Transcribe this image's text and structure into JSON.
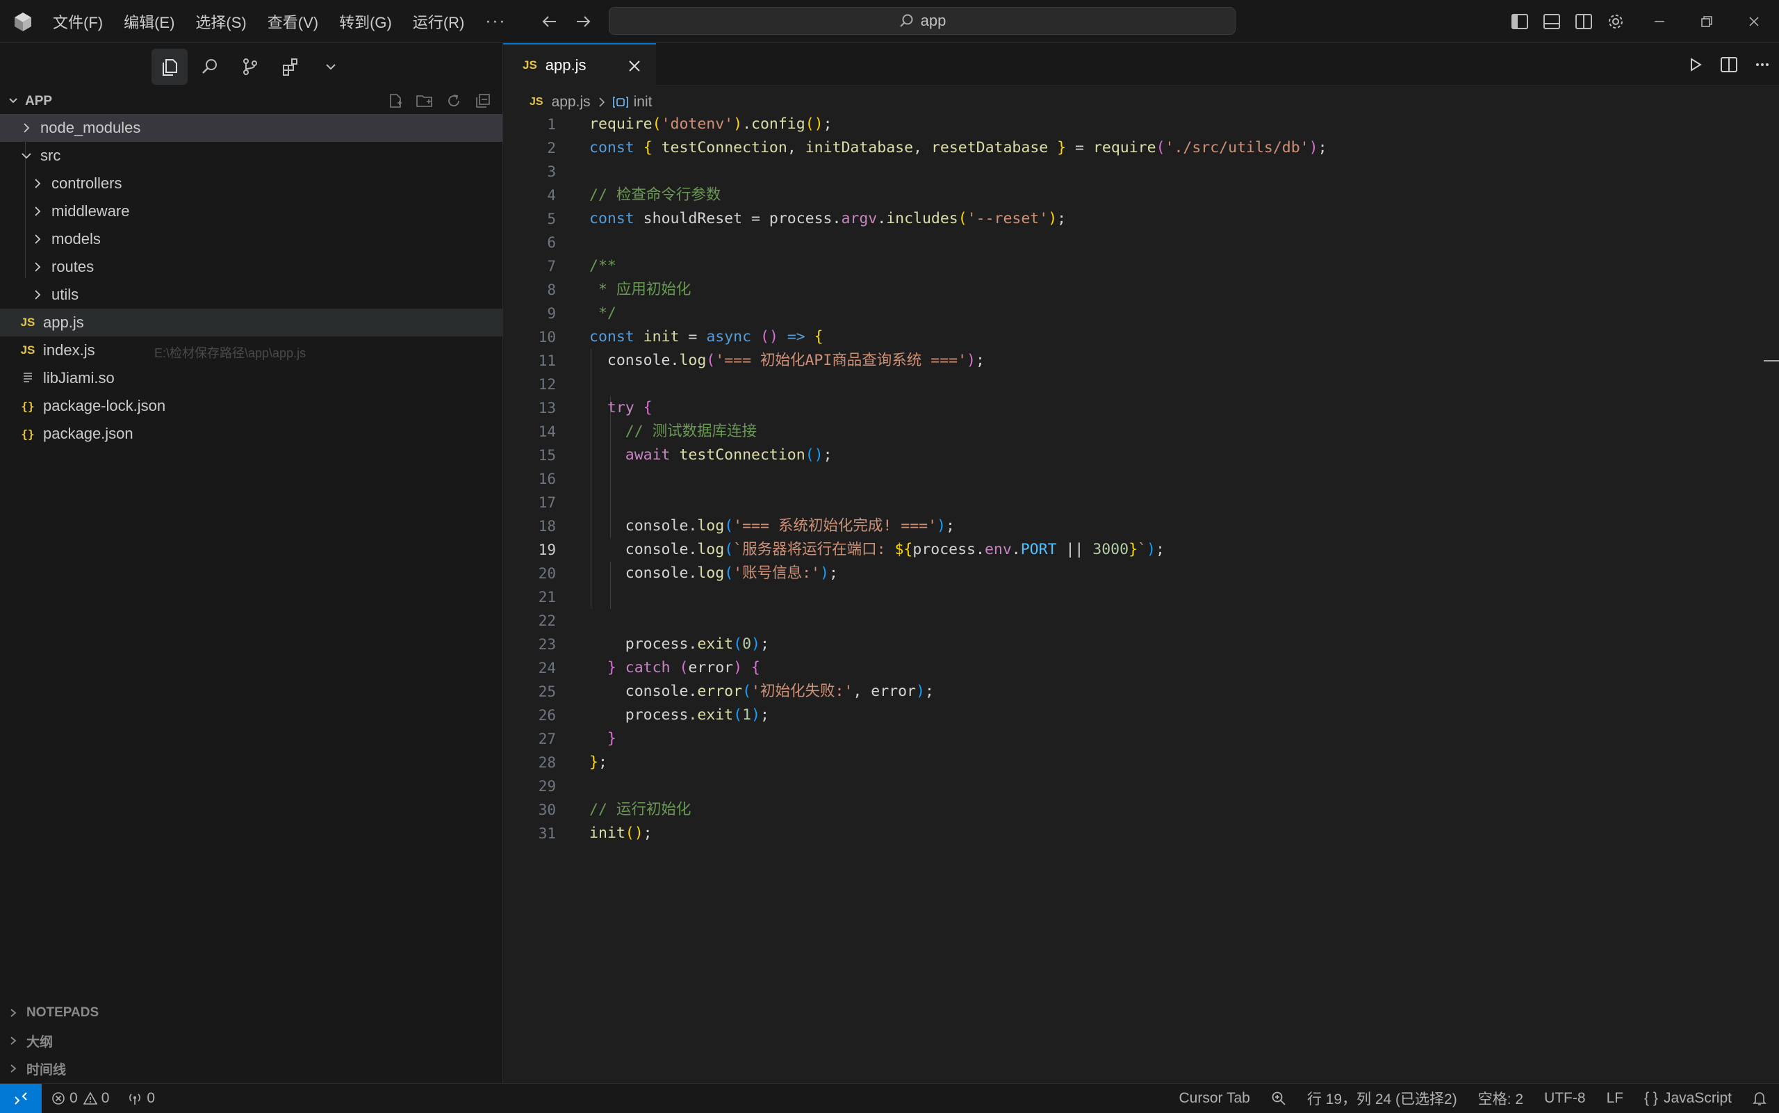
{
  "titlebar": {
    "menus": [
      "文件(F)",
      "编辑(E)",
      "选择(S)",
      "查看(V)",
      "转到(G)",
      "运行(R)"
    ],
    "more": "···",
    "search_text": "app"
  },
  "explorer": {
    "section_title": "APP",
    "items": [
      {
        "label": "node_modules",
        "type": "folder",
        "depth": 0,
        "expanded": false
      },
      {
        "label": "src",
        "type": "folder",
        "depth": 0,
        "expanded": true
      },
      {
        "label": "controllers",
        "type": "folder",
        "depth": 1,
        "expanded": false
      },
      {
        "label": "middleware",
        "type": "folder",
        "depth": 1,
        "expanded": false
      },
      {
        "label": "models",
        "type": "folder",
        "depth": 1,
        "expanded": false
      },
      {
        "label": "routes",
        "type": "folder",
        "depth": 1,
        "expanded": false
      },
      {
        "label": "utils",
        "type": "folder",
        "depth": 1,
        "expanded": false
      },
      {
        "label": "app.js",
        "type": "js",
        "depth": 0
      },
      {
        "label": "index.js",
        "type": "js",
        "depth": 0
      },
      {
        "label": "libJiami.so",
        "type": "file",
        "depth": 0
      },
      {
        "label": "package-lock.json",
        "type": "json",
        "depth": 0
      },
      {
        "label": "package.json",
        "type": "json",
        "depth": 0
      }
    ],
    "hover_path": "E:\\检材保存路径\\app\\app.js",
    "file_icon_js": "JS",
    "file_icon_json": "{}",
    "bottom_sections": [
      "NOTEPADS",
      "大纲",
      "时间线"
    ]
  },
  "editor": {
    "tab_label": "app.js",
    "tab_icon": "JS",
    "breadcrumb_file": "app.js",
    "breadcrumb_symbol": "init",
    "current_line": 19,
    "lines": [
      [
        [
          "require",
          "#dcdcaa"
        ],
        [
          "(",
          "#ffd700"
        ],
        [
          "'dotenv'",
          "#ce9178"
        ],
        [
          ")",
          "#ffd700"
        ],
        [
          ".",
          "#d4d4d4"
        ],
        [
          "config",
          "#dcdcaa"
        ],
        [
          "()",
          "#ffd700"
        ],
        [
          ";",
          "#d4d4d4"
        ]
      ],
      [
        [
          "const",
          "#569cd6"
        ],
        [
          " ",
          "#d4d4d4"
        ],
        [
          "{",
          "#ffd700"
        ],
        [
          " testConnection",
          "#dcdcaa"
        ],
        [
          ", ",
          "#d4d4d4"
        ],
        [
          "initDatabase",
          "#dcdcaa"
        ],
        [
          ", ",
          "#d4d4d4"
        ],
        [
          "resetDatabase",
          "#dcdcaa"
        ],
        [
          " }",
          "#ffd700"
        ],
        [
          " = ",
          "#d4d4d4"
        ],
        [
          "require",
          "#dcdcaa"
        ],
        [
          "(",
          "#da70d6"
        ],
        [
          "'./src/utils/db'",
          "#ce9178"
        ],
        [
          ")",
          "#da70d6"
        ],
        [
          ";",
          "#d4d4d4"
        ]
      ],
      [],
      [
        [
          "// 检查命令行参数",
          "#6a9955"
        ]
      ],
      [
        [
          "const",
          "#569cd6"
        ],
        [
          " shouldReset = process.",
          "#d4d4d4"
        ],
        [
          "argv",
          "#c586c0"
        ],
        [
          ".",
          "#d4d4d4"
        ],
        [
          "includes",
          "#dcdcaa"
        ],
        [
          "(",
          "#ffd700"
        ],
        [
          "'--reset'",
          "#ce9178"
        ],
        [
          ")",
          "#ffd700"
        ],
        [
          ";",
          "#d4d4d4"
        ]
      ],
      [],
      [
        [
          "/**",
          "#6a9955"
        ]
      ],
      [
        [
          " * 应用初始化",
          "#6a9955"
        ]
      ],
      [
        [
          " */",
          "#6a9955"
        ]
      ],
      [
        [
          "const",
          "#569cd6"
        ],
        [
          " init",
          "#dcdcaa"
        ],
        [
          " = ",
          "#d4d4d4"
        ],
        [
          "async",
          "#569cd6"
        ],
        [
          " ",
          "#d4d4d4"
        ],
        [
          "()",
          "#da70d6"
        ],
        [
          " => ",
          "#569cd6"
        ],
        [
          "{",
          "#ffd700"
        ]
      ],
      [
        [
          "  console.",
          "#d4d4d4"
        ],
        [
          "log",
          "#dcdcaa"
        ],
        [
          "(",
          "#da70d6"
        ],
        [
          "'=== 初始化API商品查询系统 ==='",
          "#ce9178"
        ],
        [
          ")",
          "#da70d6"
        ],
        [
          ";",
          "#d4d4d4"
        ]
      ],
      [],
      [
        [
          "  ",
          "#d4d4d4"
        ],
        [
          "try",
          "#c586c0"
        ],
        [
          " {",
          "#da70d6"
        ]
      ],
      [
        [
          "    // 测试数据库连接",
          "#6a9955"
        ]
      ],
      [
        [
          "    ",
          "#d4d4d4"
        ],
        [
          "await",
          "#c586c0"
        ],
        [
          " testConnection",
          "#dcdcaa"
        ],
        [
          "()",
          "#179fff"
        ],
        [
          ";",
          "#d4d4d4"
        ]
      ],
      [],
      [],
      [
        [
          "    console.",
          "#d4d4d4"
        ],
        [
          "log",
          "#dcdcaa"
        ],
        [
          "(",
          "#179fff"
        ],
        [
          "'=== 系统初始化完成! ==='",
          "#ce9178"
        ],
        [
          ")",
          "#179fff"
        ],
        [
          ";",
          "#d4d4d4"
        ]
      ],
      [
        [
          "    console.",
          "#d4d4d4"
        ],
        [
          "log",
          "#dcdcaa"
        ],
        [
          "(",
          "#179fff"
        ],
        [
          "`服务器将运行在端口: ",
          "#ce9178"
        ],
        [
          "${",
          "#ffd700"
        ],
        [
          "process.",
          "#d4d4d4"
        ],
        [
          "env",
          "#c586c0"
        ],
        [
          ".",
          "#d4d4d4"
        ],
        [
          "PORT",
          "#4fc1ff"
        ],
        [
          " || ",
          "#d4d4d4"
        ],
        [
          "3000",
          "#b5cea8"
        ],
        [
          "}",
          "#ffd700"
        ],
        [
          "`",
          "#ce9178"
        ],
        [
          ")",
          "#179fff"
        ],
        [
          ";",
          "#d4d4d4"
        ]
      ],
      [
        [
          "    console.",
          "#d4d4d4"
        ],
        [
          "log",
          "#dcdcaa"
        ],
        [
          "(",
          "#179fff"
        ],
        [
          "'账号信息:'",
          "#ce9178"
        ],
        [
          ")",
          "#179fff"
        ],
        [
          ";",
          "#d4d4d4"
        ]
      ],
      [],
      [],
      [
        [
          "    process.",
          "#d4d4d4"
        ],
        [
          "exit",
          "#dcdcaa"
        ],
        [
          "(",
          "#179fff"
        ],
        [
          "0",
          "#b5cea8"
        ],
        [
          ")",
          "#179fff"
        ],
        [
          ";",
          "#d4d4d4"
        ]
      ],
      [
        [
          "  }",
          "#da70d6"
        ],
        [
          " catch ",
          "#c586c0"
        ],
        [
          "(",
          "#da70d6"
        ],
        [
          "error",
          "#d4d4d4"
        ],
        [
          ")",
          "#da70d6"
        ],
        [
          " {",
          "#da70d6"
        ]
      ],
      [
        [
          "    console.",
          "#d4d4d4"
        ],
        [
          "error",
          "#dcdcaa"
        ],
        [
          "(",
          "#179fff"
        ],
        [
          "'初始化失败:'",
          "#ce9178"
        ],
        [
          ", error",
          "#d4d4d4"
        ],
        [
          ")",
          "#179fff"
        ],
        [
          ";",
          "#d4d4d4"
        ]
      ],
      [
        [
          "    process.",
          "#d4d4d4"
        ],
        [
          "exit",
          "#dcdcaa"
        ],
        [
          "(",
          "#179fff"
        ],
        [
          "1",
          "#b5cea8"
        ],
        [
          ")",
          "#179fff"
        ],
        [
          ";",
          "#d4d4d4"
        ]
      ],
      [
        [
          "  }",
          "#da70d6"
        ]
      ],
      [
        [
          "}",
          "#ffd700"
        ],
        [
          ";",
          "#d4d4d4"
        ]
      ],
      [],
      [
        [
          "// 运行初始化",
          "#6a9955"
        ]
      ],
      [
        [
          "init",
          "#dcdcaa"
        ],
        [
          "()",
          "#ffd700"
        ],
        [
          ";",
          "#d4d4d4"
        ]
      ]
    ]
  },
  "statusbar": {
    "errors": "0",
    "warnings": "0",
    "ports": "0",
    "cursor_tab": "Cursor Tab",
    "position": "行 19，列 24 (已选择2)",
    "spaces": "空格: 2",
    "encoding": "UTF-8",
    "eol": "LF",
    "language": "JavaScript",
    "remote_color": "#0078d4"
  }
}
